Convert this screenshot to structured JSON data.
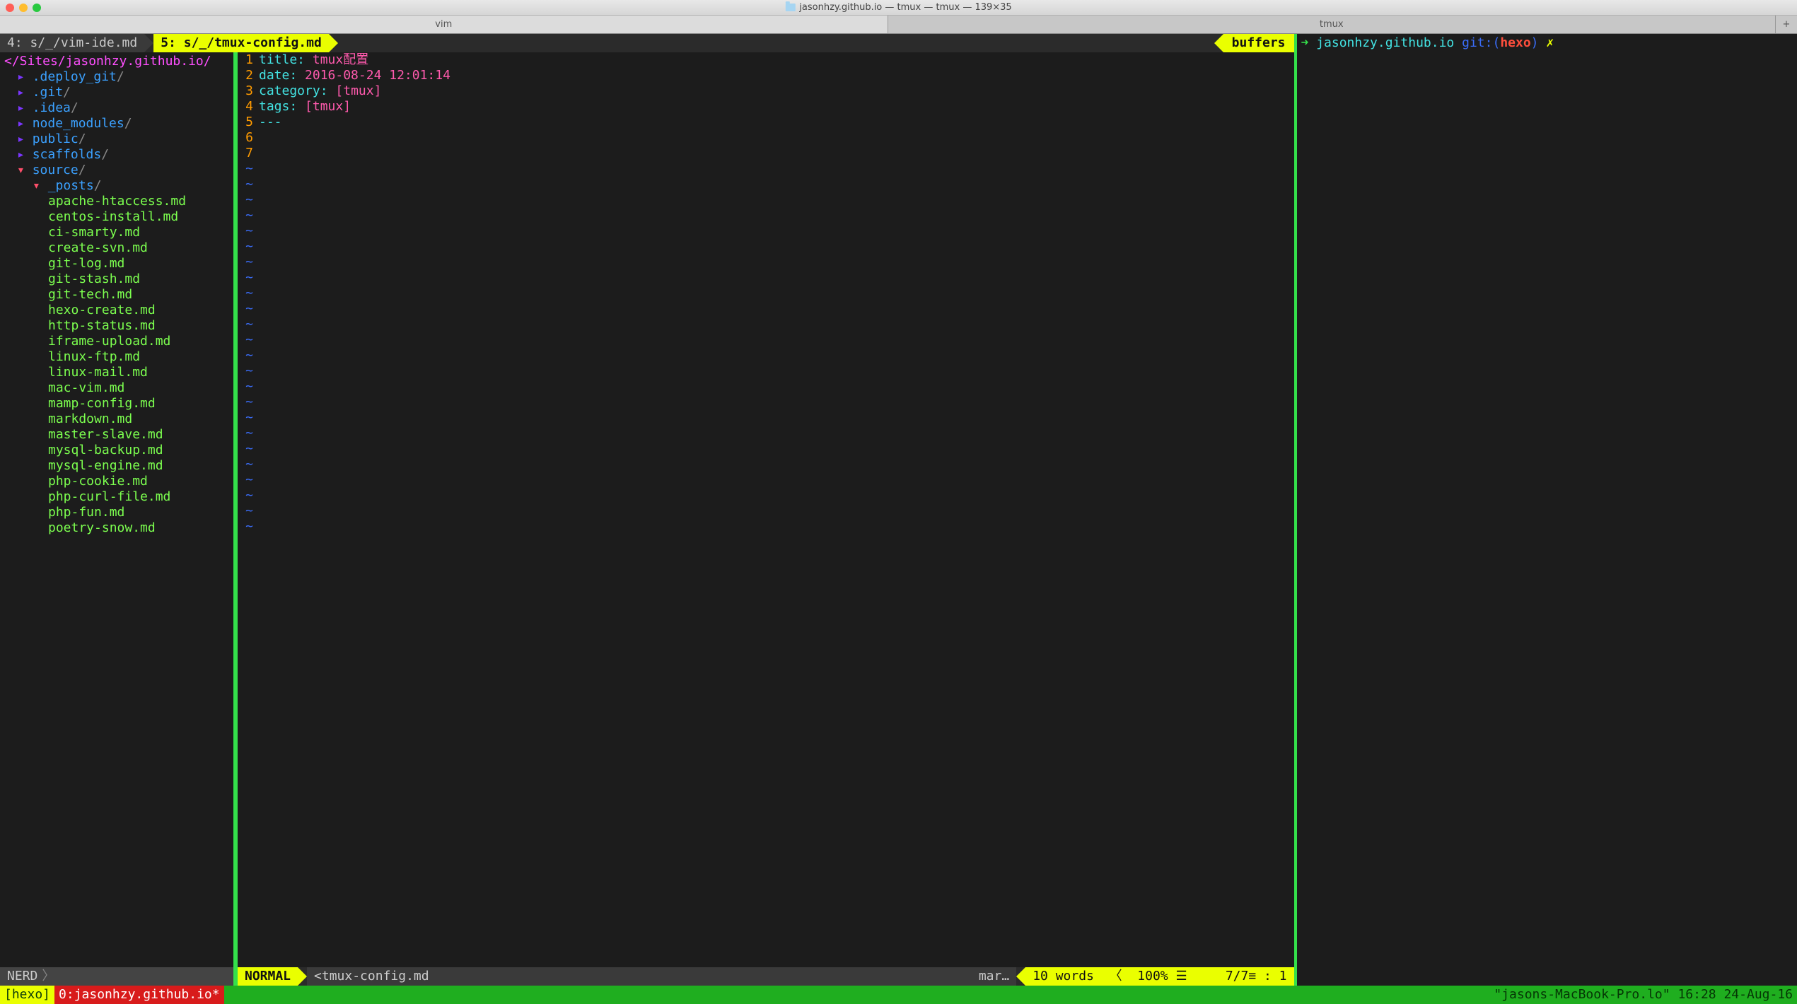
{
  "window": {
    "title": "jasonhzy.github.io — tmux — tmux — 139×35"
  },
  "app_tabs": {
    "left": "vim",
    "right": "tmux",
    "plus": "+"
  },
  "vim": {
    "tabline": {
      "inactive": " 4: s/_/vim-ide.md ",
      "active": " 5: s/_/tmux-config.md ",
      "buffers": "buffers"
    },
    "nerdtree": {
      "root": "</Sites/jasonhzy.github.io/",
      "dirs_closed": [
        ".deploy_git",
        ".git",
        ".idea",
        "node_modules",
        "public",
        "scaffolds"
      ],
      "dir_open": "source",
      "subdir_open": "_posts",
      "files": [
        "apache-htaccess.md",
        "centos-install.md",
        "ci-smarty.md",
        "create-svn.md",
        "git-log.md",
        "git-stash.md",
        "git-tech.md",
        "hexo-create.md",
        "http-status.md",
        "iframe-upload.md",
        "linux-ftp.md",
        "linux-mail.md",
        "mac-vim.md",
        "mamp-config.md",
        "markdown.md",
        "master-slave.md",
        "mysql-backup.md",
        "mysql-engine.md",
        "php-cookie.md",
        "php-curl-file.md",
        "php-fun.md",
        "poetry-snow.md"
      ]
    },
    "editor": {
      "lines": [
        {
          "n": "1",
          "kw": "title:",
          "val": "tmux配置"
        },
        {
          "n": "2",
          "kw": "date:",
          "val": "2016-08-24 12:01:14"
        },
        {
          "n": "3",
          "kw": "category:",
          "val": "[tmux]"
        },
        {
          "n": "4",
          "kw": "tags:",
          "val": "[tmux]"
        },
        {
          "n": "5",
          "kw": "---",
          "val": ""
        },
        {
          "n": "6",
          "kw": "",
          "val": ""
        },
        {
          "n": "7",
          "kw": "",
          "val": ""
        }
      ]
    },
    "statusline": {
      "nerd": "NERD",
      "mode": "NORMAL",
      "filename": "<tmux-config.md",
      "filetype": "mar…",
      "words": "10 words",
      "percent": "100% ☰",
      "pos": "7/7≡ :   1"
    }
  },
  "shell": {
    "arrow": "➜ ",
    "cwd": "jasonhzy.github.io",
    "git_label": "git:(",
    "branch": "hexo",
    "git_close": ")",
    "dirty": "✗"
  },
  "tmux": {
    "session": "[hexo]",
    "window_active": "0:jasonhzy.github.io*",
    "right": "\"jasons-MacBook-Pro.lo\" 16:28 24-Aug-16"
  }
}
